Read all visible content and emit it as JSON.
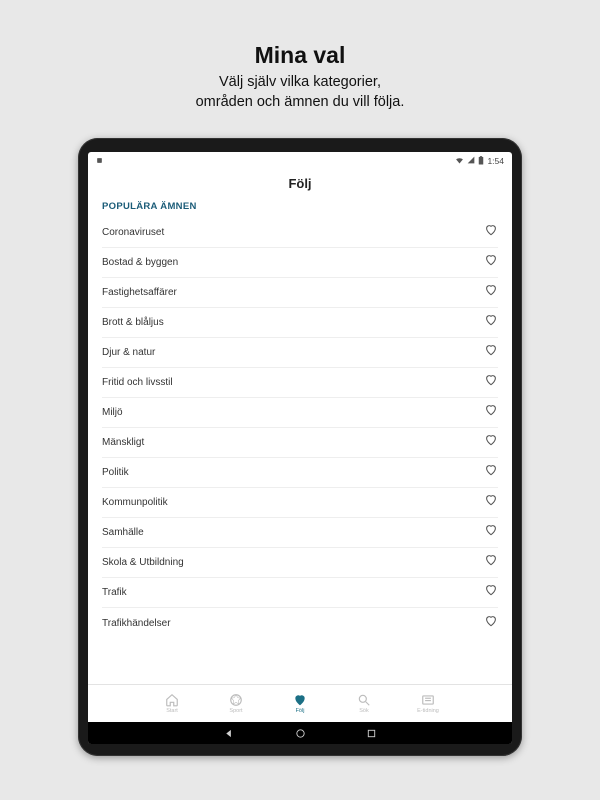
{
  "promo": {
    "title": "Mina val",
    "subtitle_line1": "Välj själv vilka kategorier,",
    "subtitle_line2": "områden och ämnen du vill följa."
  },
  "statusbar": {
    "time": "1:54"
  },
  "page": {
    "title": "Följ",
    "section_header": "POPULÄRA ÄMNEN"
  },
  "topics": [
    {
      "label": "Coronaviruset"
    },
    {
      "label": "Bostad & byggen"
    },
    {
      "label": "Fastighetsaffärer"
    },
    {
      "label": "Brott & blåljus"
    },
    {
      "label": "Djur & natur"
    },
    {
      "label": "Fritid och livsstil"
    },
    {
      "label": "Miljö"
    },
    {
      "label": "Mänskligt"
    },
    {
      "label": "Politik"
    },
    {
      "label": "Kommunpolitik"
    },
    {
      "label": "Samhälle"
    },
    {
      "label": "Skola & Utbildning"
    },
    {
      "label": "Trafik"
    },
    {
      "label": "Trafikhändelser"
    }
  ],
  "tabs": [
    {
      "label": "Start"
    },
    {
      "label": "Sport"
    },
    {
      "label": "Följ"
    },
    {
      "label": "Sök"
    },
    {
      "label": "E-tidning"
    }
  ]
}
